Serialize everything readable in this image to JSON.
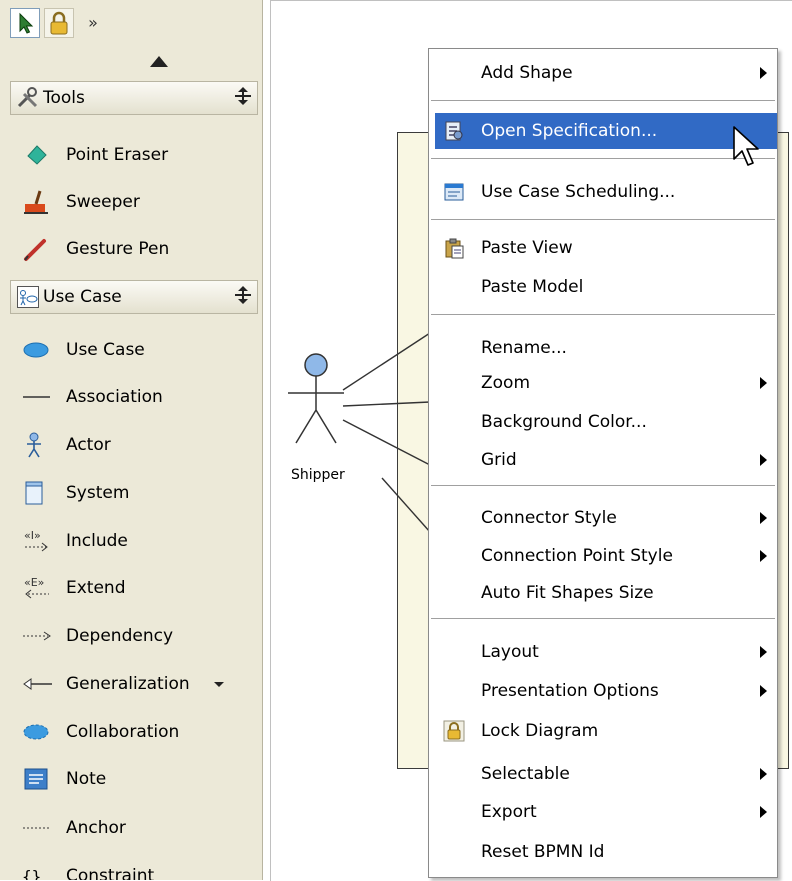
{
  "palette": {
    "top_more": "»",
    "tools_group": {
      "label": "Tools",
      "move_glyph": "⵲"
    },
    "tools_items": [
      {
        "label": "Point Eraser"
      },
      {
        "label": "Sweeper"
      },
      {
        "label": "Gesture Pen"
      }
    ],
    "usecase_group": {
      "label": "Use Case",
      "move_glyph": "⵲"
    },
    "usecase_items": [
      {
        "label": "Use Case"
      },
      {
        "label": "Association"
      },
      {
        "label": "Actor"
      },
      {
        "label": "System"
      },
      {
        "label": "Include"
      },
      {
        "label": "Extend"
      },
      {
        "label": "Dependency"
      },
      {
        "label": "Generalization"
      },
      {
        "label": "Collaboration"
      },
      {
        "label": "Note"
      },
      {
        "label": "Anchor"
      },
      {
        "label": "Constraint"
      }
    ]
  },
  "diagram": {
    "actor_label": "Shipper"
  },
  "context_menu": {
    "items": [
      {
        "label": "Add Shape"
      },
      {
        "label": "Open Specification..."
      },
      {
        "label": "Use Case Scheduling..."
      },
      {
        "label": "Paste View"
      },
      {
        "label": "Paste Model"
      },
      {
        "label": "Rename..."
      },
      {
        "label": "Zoom"
      },
      {
        "label": "Background Color..."
      },
      {
        "label": "Grid"
      },
      {
        "label": "Connector Style"
      },
      {
        "label": "Connection Point Style"
      },
      {
        "label": "Auto Fit Shapes Size"
      },
      {
        "label": "Layout"
      },
      {
        "label": "Presentation Options"
      },
      {
        "label": "Lock Diagram"
      },
      {
        "label": "Selectable"
      },
      {
        "label": "Export"
      },
      {
        "label": "Reset BPMN Id"
      }
    ]
  },
  "colors": {
    "palette_bg": "#ece9d8",
    "highlight": "#316ac5",
    "system_fill": "#f9f7e3",
    "actor_fill": "#8fb8e8"
  }
}
